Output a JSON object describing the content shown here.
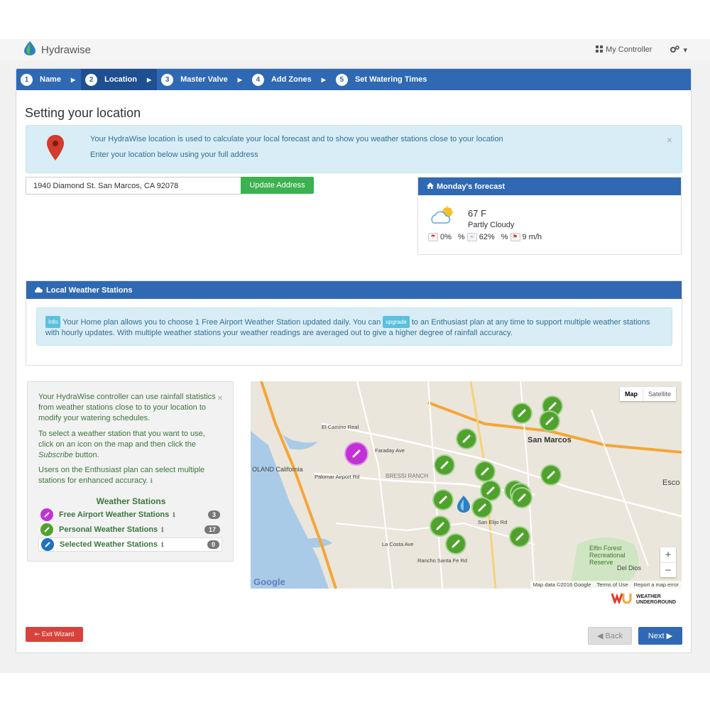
{
  "app": {
    "name": "Hydrawise"
  },
  "topnav": {
    "controller_label": "My Controller",
    "settings_caret": "▾"
  },
  "steps": [
    {
      "num": "1",
      "label": "Name"
    },
    {
      "num": "2",
      "label": "Location",
      "active": true
    },
    {
      "num": "3",
      "label": "Master Valve"
    },
    {
      "num": "4",
      "label": "Add Zones"
    },
    {
      "num": "5",
      "label": "Set Watering Times"
    }
  ],
  "page": {
    "title": "Setting your location"
  },
  "location_alert": {
    "line1": "Your HydraWise location is used to calculate your local forecast and to show you weather stations close to your location",
    "line2": "Enter your location below using your full address",
    "close": "×"
  },
  "address": {
    "value": "1940 Diamond St. San Marcos, CA 92078",
    "button_label": "Update Address"
  },
  "forecast": {
    "title": "Monday's forecast",
    "temperature": "67 F",
    "condition": "Partly Cloudy",
    "rain_chance": "0%",
    "rain_unit": "%",
    "humidity": "62%",
    "humidity_unit": "%",
    "wind": "9 m/h"
  },
  "stations": {
    "title": "Local Weather Stations",
    "info_tag": "Info",
    "upgrade_tag": "upgrade",
    "info_text_1": "Your Home plan allows you to choose 1 Free Airport Weather Station updated daily. You can",
    "info_text_2": "to an Enthusiast plan at any time to support multiple weather stations with hourly updates. With multiple weather stations your weather readings are averaged out to give a higher degree of rainfall accuracy."
  },
  "sidebox": {
    "para1": "Your HydraWise controller can use rainfall statistics from weather stations close to to your location to modify your watering schedules.",
    "para2a": "To select a weather station that you want to use, click on an icon on the map and then click the",
    "para2b": "Subscribe",
    "para2c": "button.",
    "para3": "Users on the Enthusiast plan can select multiple stations for enhanced accuracy.",
    "title": "Weather Stations",
    "close": "×",
    "legend": [
      {
        "label": "Free Airport Weather Stations",
        "count": "3",
        "color": "#c331d6"
      },
      {
        "label": "Personal Weather Stations",
        "count": "17",
        "color": "#4fa32c"
      },
      {
        "label": "Selected Weather Stations",
        "count": "0",
        "color": "#1e73be"
      }
    ]
  },
  "map": {
    "type_map": "Map",
    "type_satellite": "Satellite",
    "zoom_in": "+",
    "zoom_out": "−",
    "labels": {
      "san_marcos": "San Marcos",
      "carlsbad": "OLAND California",
      "bressi": "BRESSI RANCH",
      "esco": "Esco",
      "elfin": "Elfin Forest Recreational Reserve",
      "del_dios": "Del Dios",
      "el_camino": "El Camino Real",
      "palomar": "Palomar Airport Rd",
      "faraday": "Faraday Ave",
      "la_costa": "La Costa Ave",
      "san_elijo": "San Elijo Rd",
      "rancho": "Rancho Santa Fe Rd"
    },
    "google": "Google",
    "footer_data": "Map data ©2016 Google",
    "footer_terms": "Terms of Use",
    "footer_report": "Report a map error"
  },
  "wu": {
    "line1": "WEATHER",
    "line2": "UNDERGROUND"
  },
  "buttons": {
    "exit": "Exit Wizard",
    "back": "Back",
    "next": "Next"
  },
  "colors": {
    "primary": "#2f69b3",
    "success": "#3cb14f",
    "danger": "#d9413b",
    "info_bg": "#d9edf7"
  }
}
